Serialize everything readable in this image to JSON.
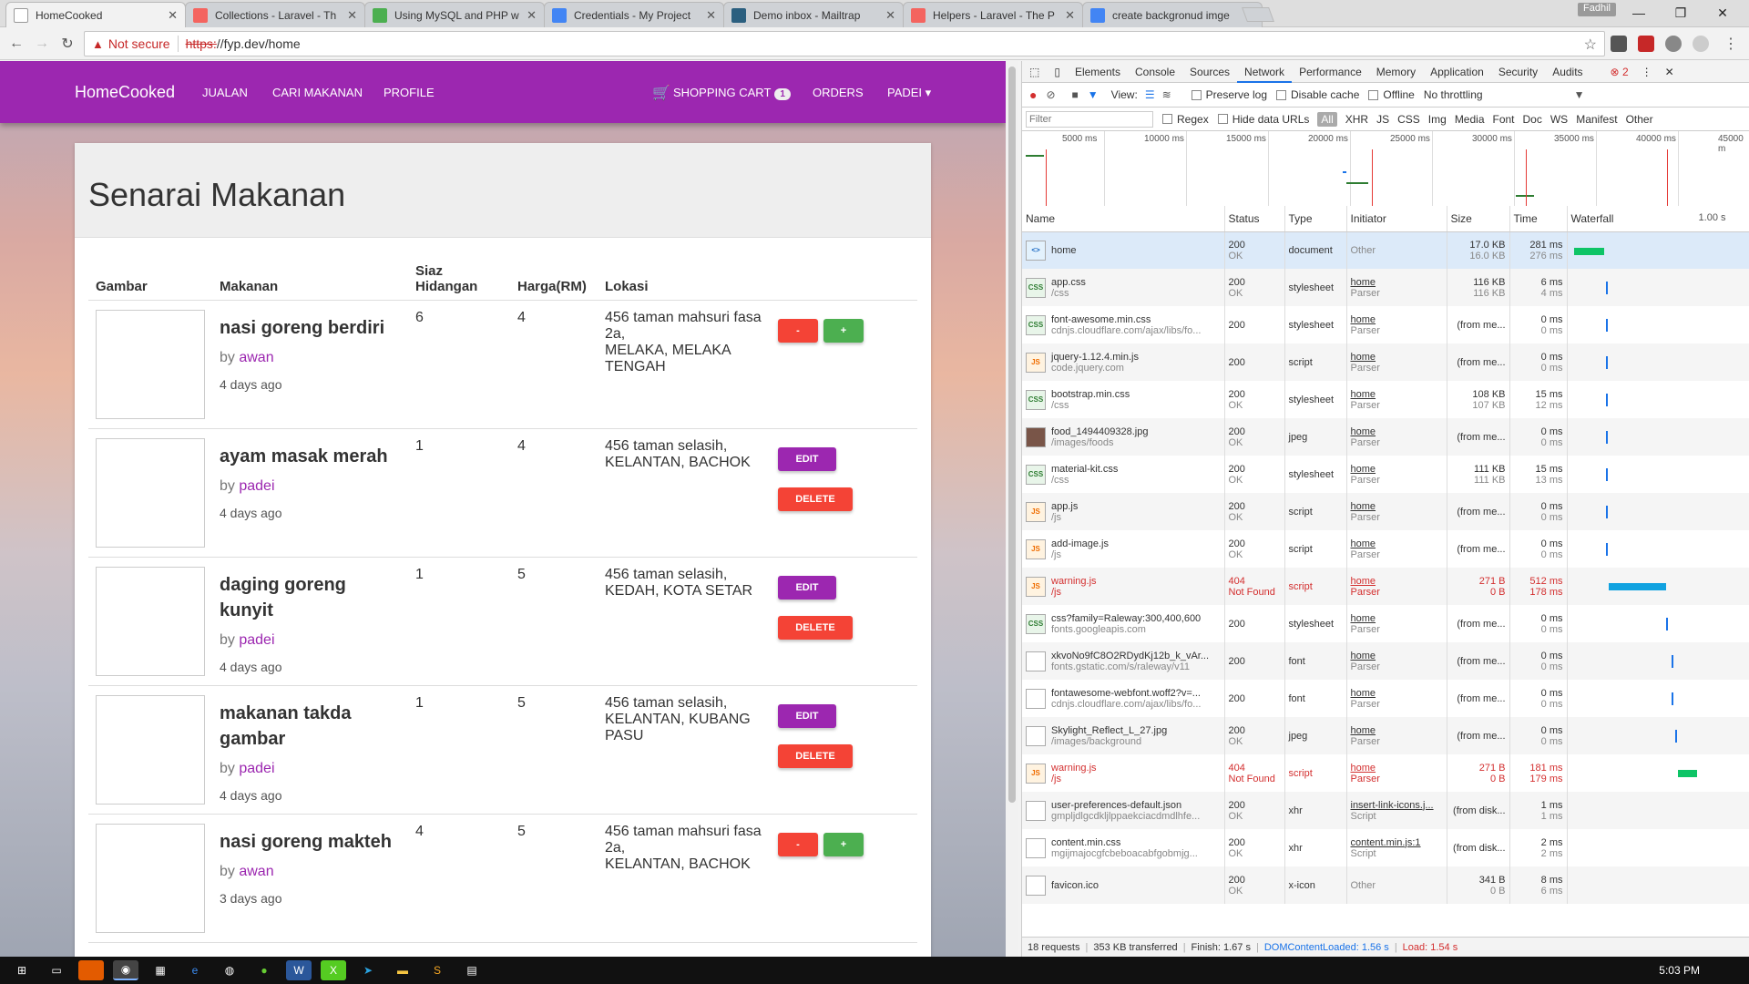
{
  "browser": {
    "tabs": [
      {
        "label": "HomeCooked",
        "color": "#ffffff",
        "active": true
      },
      {
        "label": "Collections - Laravel - Th",
        "color": "#f4645f"
      },
      {
        "label": "Using MySQL and PHP w",
        "color": "#4caf50"
      },
      {
        "label": "Credentials - My Project",
        "color": "#4285f4"
      },
      {
        "label": "Demo inbox - Mailtrap",
        "color": "#2b5f7f"
      },
      {
        "label": "Helpers - Laravel - The P",
        "color": "#f4645f"
      },
      {
        "label": "create backgronud imge",
        "color": "#4285f4"
      }
    ],
    "profile": "Fadhil",
    "not_secure": "Not secure",
    "url_scheme": "https:",
    "url_rest": "//fyp.dev/home"
  },
  "navbar": {
    "brand": "HomeCooked",
    "links": [
      "JUALAN",
      "CARI MAKANAN",
      "PROFILE"
    ],
    "cart_label": "SHOPPING CART",
    "cart_count": "1",
    "orders": "ORDERS",
    "user": "PADEI ▾"
  },
  "page": {
    "title": "Senarai Makanan",
    "columns": [
      "Gambar",
      "Makanan",
      "Siaz Hidangan",
      "Harga(RM)",
      "Lokasi"
    ],
    "rows": [
      {
        "name": "nasi goreng berdiri",
        "by": "by ",
        "author": "awan",
        "ago": "4 days ago",
        "qty": "6",
        "price": "4",
        "loc": "456 taman mahsuri fasa 2a,\nMELAKA, MELAKA TENGAH",
        "mode": "cart",
        "minus": "-",
        "plus": "+"
      },
      {
        "name": "ayam masak merah",
        "by": "by ",
        "author": "padei",
        "ago": "4 days ago",
        "qty": "1",
        "price": "4",
        "loc": "456 taman selasih,\nKELANTAN, BACHOK",
        "mode": "own",
        "edit": "EDIT",
        "delete": "DELETE"
      },
      {
        "name": "daging goreng kunyit",
        "by": "by ",
        "author": "padei",
        "ago": "4 days ago",
        "qty": "1",
        "price": "5",
        "loc": "456 taman selasih,\nKEDAH, KOTA SETAR",
        "mode": "own",
        "edit": "EDIT",
        "delete": "DELETE"
      },
      {
        "name": "makanan takda gambar",
        "by": "by ",
        "author": "padei",
        "ago": "4 days ago",
        "qty": "1",
        "price": "5",
        "loc": "456 taman selasih,\nKELANTAN, KUBANG PASU",
        "mode": "own",
        "edit": "EDIT",
        "delete": "DELETE"
      },
      {
        "name": "nasi goreng makteh",
        "by": "by ",
        "author": "awan",
        "ago": "3 days ago",
        "qty": "4",
        "price": "5",
        "loc": "456 taman mahsuri fasa 2a,\nKELANTAN, BACHOK",
        "mode": "cart",
        "minus": "-",
        "plus": "+"
      }
    ]
  },
  "devtools": {
    "tabs": [
      "Elements",
      "Console",
      "Sources",
      "Network",
      "Performance",
      "Memory",
      "Application",
      "Security",
      "Audits"
    ],
    "error_count": "2",
    "view_label": "View:",
    "preserve_log": "Preserve log",
    "disable_cache": "Disable cache",
    "offline": "Offline",
    "throttling": "No throttling",
    "filter_placeholder": "Filter",
    "regex": "Regex",
    "hide_data_urls": "Hide data URLs",
    "types": [
      "All",
      "XHR",
      "JS",
      "CSS",
      "Img",
      "Media",
      "Font",
      "Doc",
      "WS",
      "Manifest",
      "Other"
    ],
    "timeline_ticks": [
      "5000 ms",
      "10000 ms",
      "15000 ms",
      "20000 ms",
      "25000 ms",
      "30000 ms",
      "35000 ms",
      "40000 ms",
      "45000 m"
    ],
    "columns": [
      "Name",
      "Status",
      "Type",
      "Initiator",
      "Size",
      "Time",
      "Waterfall"
    ],
    "waterfall_scale": "1.00 s",
    "requests": [
      {
        "name": "home",
        "path": "",
        "status": "200",
        "status2": "OK",
        "type": "document",
        "init": "Other",
        "init2": "",
        "size": "17.0 KB",
        "size2": "16.0 KB",
        "time": "281 ms",
        "time2": "276 ms",
        "icon": "doc",
        "icon_text": "<>",
        "err": false,
        "wf_start": 0.02,
        "wf_len": 0.17,
        "wf_color": "#0ec466"
      },
      {
        "name": "app.css",
        "path": "/css",
        "status": "200",
        "status2": "OK",
        "type": "stylesheet",
        "init": "home",
        "init2": "Parser",
        "size": "116 KB",
        "size2": "116 KB",
        "time": "6 ms",
        "time2": "4 ms",
        "icon": "css",
        "icon_text": "CSS",
        "err": false,
        "wf_start": 0.2,
        "wf_len": 0.01,
        "wf_color": "#1a73e8"
      },
      {
        "name": "font-awesome.min.css",
        "path": "cdnjs.cloudflare.com/ajax/libs/fo...",
        "status": "200",
        "status2": "",
        "type": "stylesheet",
        "init": "home",
        "init2": "Parser",
        "size": "(from me...",
        "size2": "",
        "time": "0 ms",
        "time2": "0 ms",
        "icon": "css",
        "icon_text": "CSS",
        "err": false,
        "wf_start": 0.2,
        "wf_len": 0.01,
        "wf_color": "#1a73e8"
      },
      {
        "name": "jquery-1.12.4.min.js",
        "path": "code.jquery.com",
        "status": "200",
        "status2": "",
        "type": "script",
        "init": "home",
        "init2": "Parser",
        "size": "(from me...",
        "size2": "",
        "time": "0 ms",
        "time2": "0 ms",
        "icon": "js",
        "icon_text": "JS",
        "err": false,
        "wf_start": 0.2,
        "wf_len": 0.01,
        "wf_color": "#1a73e8"
      },
      {
        "name": "bootstrap.min.css",
        "path": "/css",
        "status": "200",
        "status2": "OK",
        "type": "stylesheet",
        "init": "home",
        "init2": "Parser",
        "size": "108 KB",
        "size2": "107 KB",
        "time": "15 ms",
        "time2": "12 ms",
        "icon": "css",
        "icon_text": "CSS",
        "err": false,
        "wf_start": 0.2,
        "wf_len": 0.01,
        "wf_color": "#1a73e8"
      },
      {
        "name": "food_1494409328.jpg",
        "path": "/images/foods",
        "status": "200",
        "status2": "OK",
        "type": "jpeg",
        "init": "home",
        "init2": "Parser",
        "size": "(from me...",
        "size2": "",
        "time": "0 ms",
        "time2": "0 ms",
        "icon": "img",
        "icon_text": "",
        "err": false,
        "wf_start": 0.2,
        "wf_len": 0.01,
        "wf_color": "#1a73e8"
      },
      {
        "name": "material-kit.css",
        "path": "/css",
        "status": "200",
        "status2": "OK",
        "type": "stylesheet",
        "init": "home",
        "init2": "Parser",
        "size": "111 KB",
        "size2": "111 KB",
        "time": "15 ms",
        "time2": "13 ms",
        "icon": "css",
        "icon_text": "CSS",
        "err": false,
        "wf_start": 0.2,
        "wf_len": 0.01,
        "wf_color": "#1a73e8"
      },
      {
        "name": "app.js",
        "path": "/js",
        "status": "200",
        "status2": "OK",
        "type": "script",
        "init": "home",
        "init2": "Parser",
        "size": "(from me...",
        "size2": "",
        "time": "0 ms",
        "time2": "0 ms",
        "icon": "js",
        "icon_text": "JS",
        "err": false,
        "wf_start": 0.2,
        "wf_len": 0.01,
        "wf_color": "#1a73e8"
      },
      {
        "name": "add-image.js",
        "path": "/js",
        "status": "200",
        "status2": "OK",
        "type": "script",
        "init": "home",
        "init2": "Parser",
        "size": "(from me...",
        "size2": "",
        "time": "0 ms",
        "time2": "0 ms",
        "icon": "js",
        "icon_text": "JS",
        "err": false,
        "wf_start": 0.2,
        "wf_len": 0.01,
        "wf_color": "#1a73e8"
      },
      {
        "name": "warning.js",
        "path": "/js",
        "status": "404",
        "status2": "Not Found",
        "type": "script",
        "init": "home",
        "init2": "Parser",
        "size": "271 B",
        "size2": "0 B",
        "time": "512 ms",
        "time2": "178 ms",
        "icon": "js",
        "icon_text": "JS",
        "err": true,
        "wf_start": 0.22,
        "wf_len": 0.33,
        "wf_color": "#11a2e0"
      },
      {
        "name": "css?family=Raleway:300,400,600",
        "path": "fonts.googleapis.com",
        "status": "200",
        "status2": "",
        "type": "stylesheet",
        "init": "home",
        "init2": "Parser",
        "size": "(from me...",
        "size2": "",
        "time": "0 ms",
        "time2": "0 ms",
        "icon": "css",
        "icon_text": "CSS",
        "err": false,
        "wf_start": 0.55,
        "wf_len": 0.01,
        "wf_color": "#1a73e8"
      },
      {
        "name": "xkvoNo9fC8O2RDydKj12b_k_vAr...",
        "path": "fonts.gstatic.com/s/raleway/v11",
        "status": "200",
        "status2": "",
        "type": "font",
        "init": "home",
        "init2": "Parser",
        "size": "(from me...",
        "size2": "",
        "time": "0 ms",
        "time2": "0 ms",
        "icon": "blank",
        "icon_text": "",
        "err": false,
        "wf_start": 0.58,
        "wf_len": 0.01,
        "wf_color": "#1a73e8"
      },
      {
        "name": "fontawesome-webfont.woff2?v=...",
        "path": "cdnjs.cloudflare.com/ajax/libs/fo...",
        "status": "200",
        "status2": "",
        "type": "font",
        "init": "home",
        "init2": "Parser",
        "size": "(from me...",
        "size2": "",
        "time": "0 ms",
        "time2": "0 ms",
        "icon": "blank",
        "icon_text": "",
        "err": false,
        "wf_start": 0.58,
        "wf_len": 0.01,
        "wf_color": "#1a73e8"
      },
      {
        "name": "Skylight_Reflect_L_27.jpg",
        "path": "/images/background",
        "status": "200",
        "status2": "OK",
        "type": "jpeg",
        "init": "home",
        "init2": "Parser",
        "size": "(from me...",
        "size2": "",
        "time": "0 ms",
        "time2": "0 ms",
        "icon": "blank",
        "icon_text": "",
        "err": false,
        "wf_start": 0.6,
        "wf_len": 0.01,
        "wf_color": "#1a73e8"
      },
      {
        "name": "warning.js",
        "path": "/js",
        "status": "404",
        "status2": "Not Found",
        "type": "script",
        "init": "home",
        "init2": "Parser",
        "size": "271 B",
        "size2": "0 B",
        "time": "181 ms",
        "time2": "179 ms",
        "icon": "js",
        "icon_text": "JS",
        "err": true,
        "wf_start": 0.62,
        "wf_len": 0.11,
        "wf_color": "#0ec466"
      },
      {
        "name": "user-preferences-default.json",
        "path": "gmpljdlgcdkljlppaekciacdmdlhfe...",
        "status": "200",
        "status2": "OK",
        "type": "xhr",
        "init": "insert-link-icons.j...",
        "init2": "Script",
        "size": "(from disk...",
        "size2": "",
        "time": "1 ms",
        "time2": "1 ms",
        "icon": "blank",
        "icon_text": "",
        "err": false,
        "wf_start": 0,
        "wf_len": 0,
        "wf_color": "#1a73e8"
      },
      {
        "name": "content.min.css",
        "path": "mgijmajocgfcbeboacabfgobmjg...",
        "status": "200",
        "status2": "OK",
        "type": "xhr",
        "init": "content.min.js:1",
        "init2": "Script",
        "size": "(from disk...",
        "size2": "",
        "time": "2 ms",
        "time2": "2 ms",
        "icon": "blank",
        "icon_text": "",
        "err": false,
        "wf_start": 0,
        "wf_len": 0,
        "wf_color": "#1a73e8"
      },
      {
        "name": "favicon.ico",
        "path": "",
        "status": "200",
        "status2": "OK",
        "type": "x-icon",
        "init": "Other",
        "init2": "",
        "size": "341 B",
        "size2": "0 B",
        "time": "8 ms",
        "time2": "6 ms",
        "icon": "blank",
        "icon_text": "",
        "err": false,
        "wf_start": 0,
        "wf_len": 0,
        "wf_color": "#1a73e8"
      }
    ],
    "status_bar": {
      "requests": "18 requests",
      "transferred": "353 KB transferred",
      "finish": "Finish: 1.67 s",
      "dcl": "DOMContentLoaded: 1.56 s",
      "load": "Load: 1.54 s"
    }
  },
  "taskbar": {
    "time": "5:03 PM"
  }
}
